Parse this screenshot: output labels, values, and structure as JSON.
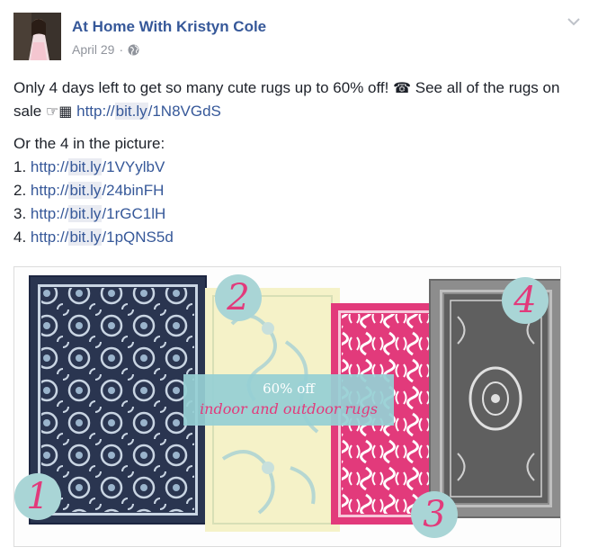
{
  "post": {
    "author": "At Home With Kristyn Cole",
    "date": "April 29",
    "separator": "·",
    "privacy_icon": "globe-icon",
    "menu_icon": "chevron-down-icon",
    "line1_text": "Only 4 days left to get so many cute rugs up to 60% off! ",
    "line1_emoji": "☎",
    "line1_cont": " See all of the rugs on sale ",
    "line1_emoji2": "☞",
    "line1_emoji3": "▦",
    "link_main_pre": "http://",
    "link_main_hl": "bit.ly",
    "link_main_post": "/1N8VGdS",
    "picture_intro": "Or the 4 in the picture:",
    "links": [
      {
        "num": "1. ",
        "pre": "http://",
        "hl": "bit.ly",
        "post": "/1VYylbV"
      },
      {
        "num": "2. ",
        "pre": "http://",
        "hl": "bit.ly",
        "post": "/24binFH"
      },
      {
        "num": "3. ",
        "pre": "http://",
        "hl": "bit.ly",
        "post": "/1rGC1lH"
      },
      {
        "num": "4. ",
        "pre": "http://",
        "hl": "bit.ly",
        "post": "/1pQNS5d"
      }
    ]
  },
  "picture": {
    "banner_top": "60% off",
    "banner_bottom": "indoor and outdoor rugs",
    "badges": [
      "1",
      "2",
      "3",
      "4"
    ]
  },
  "colors": {
    "link": "#365899",
    "badge_bg": "#a9d5d6",
    "pink": "#e23a7b",
    "navy": "#2a3550",
    "cream": "#f5f2c8",
    "gray": "#8d8d8d"
  }
}
